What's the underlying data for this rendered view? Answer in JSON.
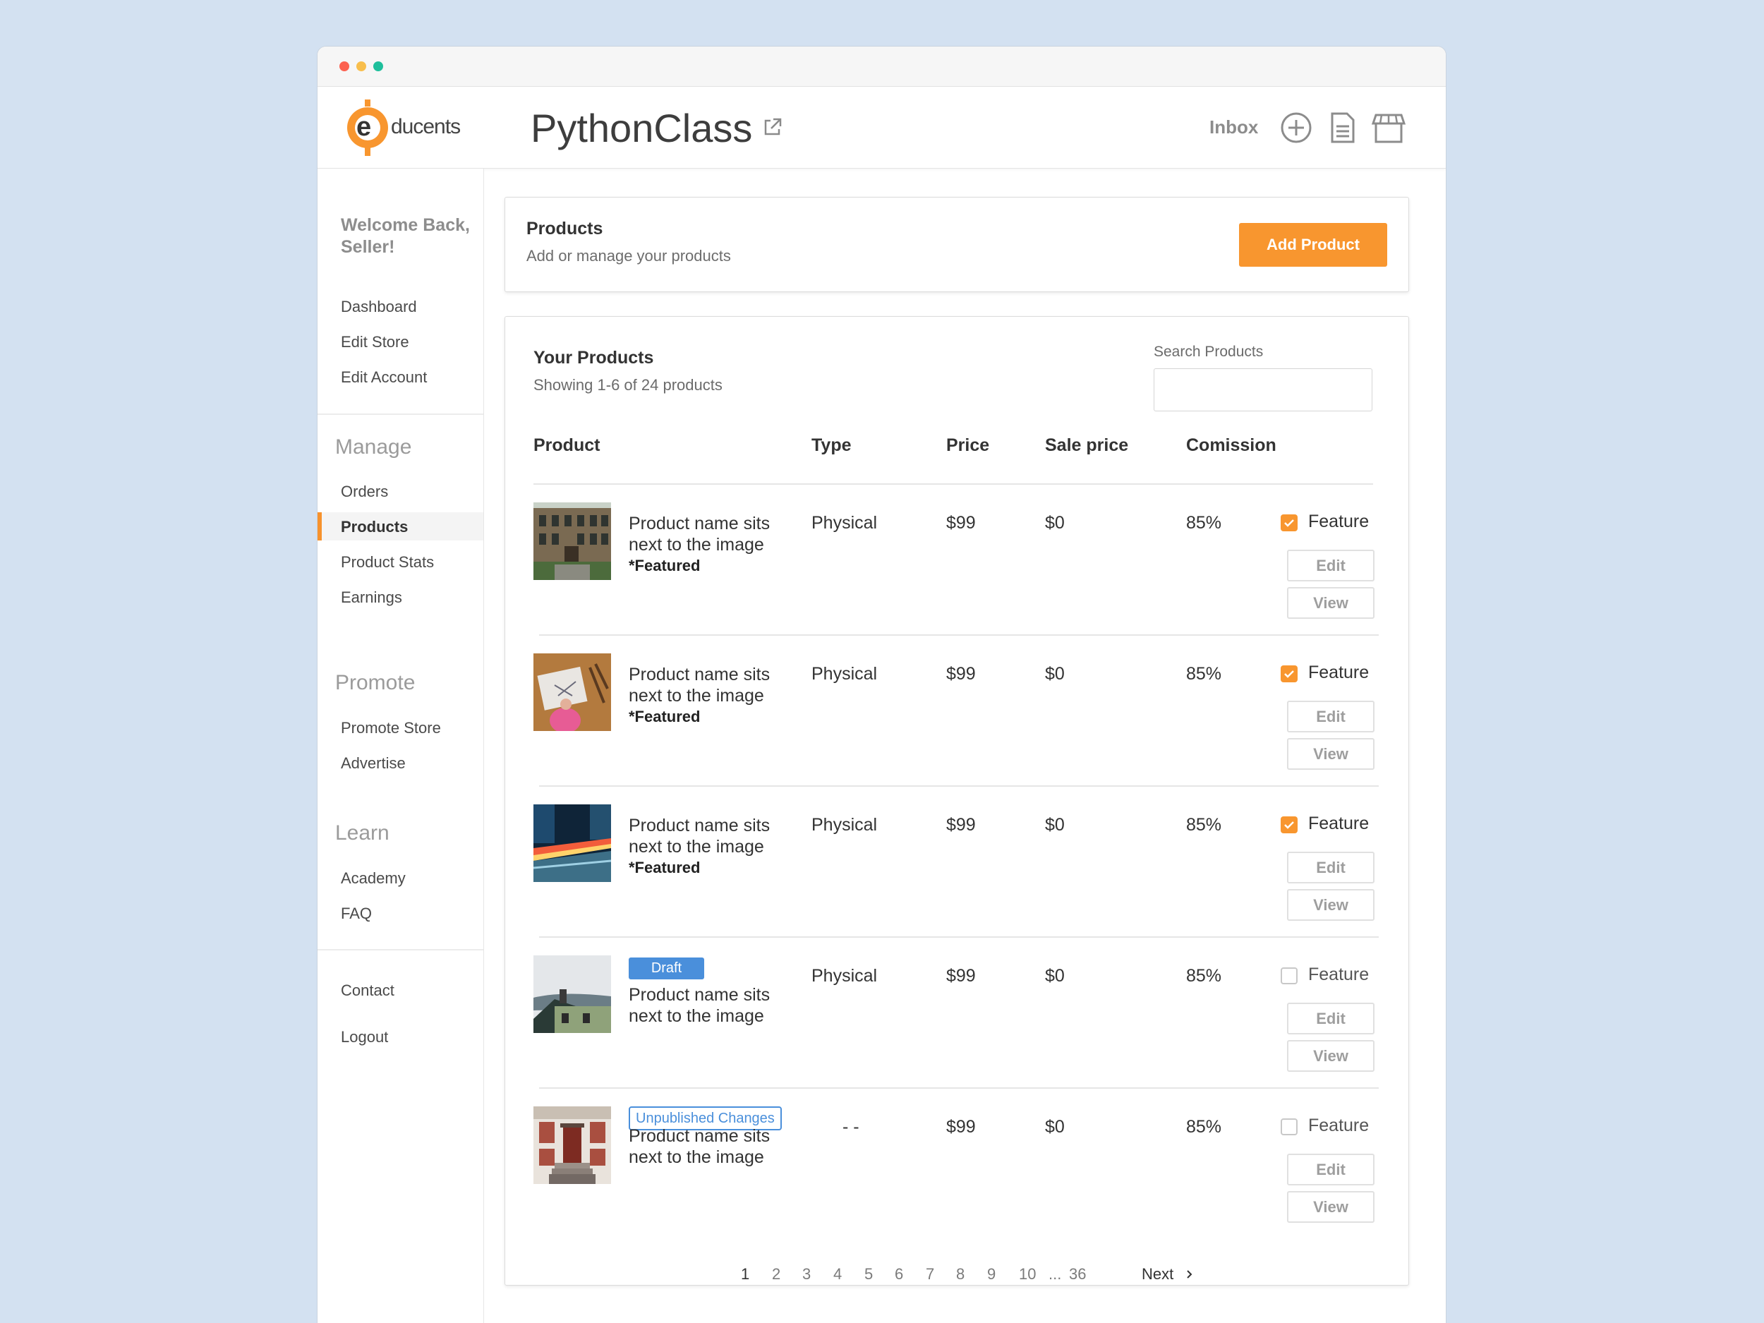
{
  "header": {
    "logo_text": "ducents",
    "logo_letter": "e",
    "app_title": "PythonClass",
    "inbox_label": "Inbox"
  },
  "sidebar": {
    "welcome": "Welcome Back, Seller!",
    "top_items": [
      "Dashboard",
      "Edit Store",
      "Edit Account"
    ],
    "manage_heading": "Manage",
    "manage_items": [
      "Orders",
      "Products",
      "Product Stats",
      "Earnings"
    ],
    "promote_heading": "Promote",
    "promote_items": [
      "Promote Store",
      "Advertise"
    ],
    "learn_heading": "Learn",
    "learn_items": [
      "Academy",
      "FAQ"
    ],
    "bottom_items": [
      "Contact",
      "Logout"
    ],
    "active_item": "Products"
  },
  "products_card": {
    "title": "Products",
    "subtitle": "Add or manage your products",
    "add_button": "Add Product"
  },
  "list": {
    "title": "Your Products",
    "subtitle": "Showing 1-6 of 24 products",
    "search_label": "Search Products",
    "search_value": "",
    "columns": [
      "Product",
      "Type",
      "Price",
      "Sale price",
      "Comission"
    ],
    "rows": [
      {
        "name_line1": "Product name sits",
        "name_line2": "next to the image",
        "featured": "*Featured",
        "badge": "",
        "type": "Physical",
        "price": "$99",
        "sale_price": "$0",
        "commission": "85%",
        "feature_checked": true,
        "feature_label": "Feature",
        "edit": "Edit",
        "view": "View",
        "thumb": "building-image"
      },
      {
        "name_line1": "Product name sits",
        "name_line2": "next to the image",
        "featured": "*Featured",
        "badge": "",
        "type": "Physical",
        "price": "$99",
        "sale_price": "$0",
        "commission": "85%",
        "feature_checked": true,
        "feature_label": "Feature",
        "edit": "Edit",
        "view": "View",
        "thumb": "drawing-image"
      },
      {
        "name_line1": "Product name sits",
        "name_line2": "next to the image",
        "featured": "*Featured",
        "badge": "",
        "type": "Physical",
        "price": "$99",
        "sale_price": "$0",
        "commission": "85%",
        "feature_checked": true,
        "feature_label": "Feature",
        "edit": "Edit",
        "view": "View",
        "thumb": "city-lights-image"
      },
      {
        "name_line1": "Product name sits",
        "name_line2": "next to the image",
        "featured": "",
        "badge": "Draft",
        "type": "Physical",
        "price": "$99",
        "sale_price": "$0",
        "commission": "85%",
        "feature_checked": false,
        "feature_label": "Feature",
        "edit": "Edit",
        "view": "View",
        "thumb": "house-image"
      },
      {
        "name_line1": "Product name sits",
        "name_line2": "next to the image",
        "featured": "",
        "badge": "Unpublished Changes",
        "type": "- -",
        "price": "$99",
        "sale_price": "$0",
        "commission": "85%",
        "feature_checked": false,
        "feature_label": "Feature",
        "edit": "Edit",
        "view": "View",
        "thumb": "doorway-image"
      }
    ]
  },
  "pagination": {
    "pages": [
      "1",
      "2",
      "3",
      "4",
      "5",
      "6",
      "7",
      "8",
      "9",
      "10",
      "...",
      "36"
    ],
    "current": "1",
    "next_label": "Next",
    "next_icon": "chevron-right-icon"
  },
  "colors": {
    "accent": "#f8962f",
    "badge_blue": "#4a8fdb",
    "background": "#d3e1f1"
  }
}
